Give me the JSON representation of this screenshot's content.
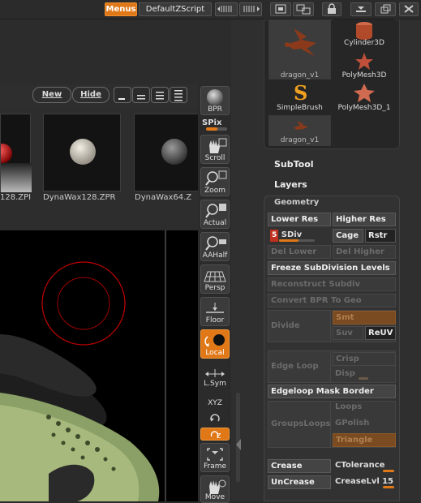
{
  "topbar": {
    "menus_label": "Menus",
    "script_label": "DefaultZScript"
  },
  "material_toolbar": {
    "new_label": "New",
    "hide_label": "Hide"
  },
  "materials": [
    {
      "label": "128.ZPI"
    },
    {
      "label": "DynaWax128.ZPR"
    },
    {
      "label": "DynaWax64.Z"
    }
  ],
  "strip": {
    "bpr_label": "BPR",
    "spix_label": "SPix",
    "scroll_label": "Scroll",
    "zoom_label": "Zoom",
    "actual_label": "Actual",
    "aahalf_label": "AAHalf",
    "persp_label": "Persp",
    "floor_label": "Floor",
    "local_label": "Local",
    "lsym_label": "L.Sym",
    "xyz_label": "XYZ",
    "frame_label": "Frame",
    "move_label": "Move"
  },
  "tools": [
    {
      "label": "dragon_v1"
    },
    {
      "label": "Cylinder3D"
    },
    {
      "label": "PolyMesh3D"
    },
    {
      "label": "SimpleBrush"
    },
    {
      "label": "PolyMesh3D_1"
    },
    {
      "label": "dragon_v1"
    }
  ],
  "sections": {
    "subtool": "SubTool",
    "layers": "Layers",
    "geometry": "Geometry"
  },
  "geometry": {
    "lower_res": "Lower Res",
    "higher_res": "Higher Res",
    "sdiv_value": "5",
    "sdiv_label": "SDiv",
    "sdiv_fraction": 0.55,
    "cage": "Cage",
    "rstr": "Rstr",
    "del_lower": "Del Lower",
    "del_higher": "Del Higher",
    "freeze": "Freeze SubDivision Levels",
    "reconstruct": "Reconstruct Subdiv",
    "convert_bpr": "Convert BPR To Geo",
    "divide": "Divide",
    "smt": "Smt",
    "suv": "Suv",
    "reuv": "ReUV",
    "edge_loop": "Edge Loop",
    "crisp": "Crisp",
    "disp": "Disp",
    "edgeloop_mask_border": "Edgeloop Mask Border",
    "groupsloops": "GroupsLoops",
    "loops": "Loops",
    "gpolish": "GPolish",
    "triangle": "Triangle",
    "crease": "Crease",
    "uncrease": "UnCrease",
    "ctolerance": "CTolerance",
    "creaselvl_label": "CreaseLvl",
    "creaselvl_value": "15"
  },
  "colors": {
    "accent": "#e07818",
    "panel": "#323232"
  }
}
